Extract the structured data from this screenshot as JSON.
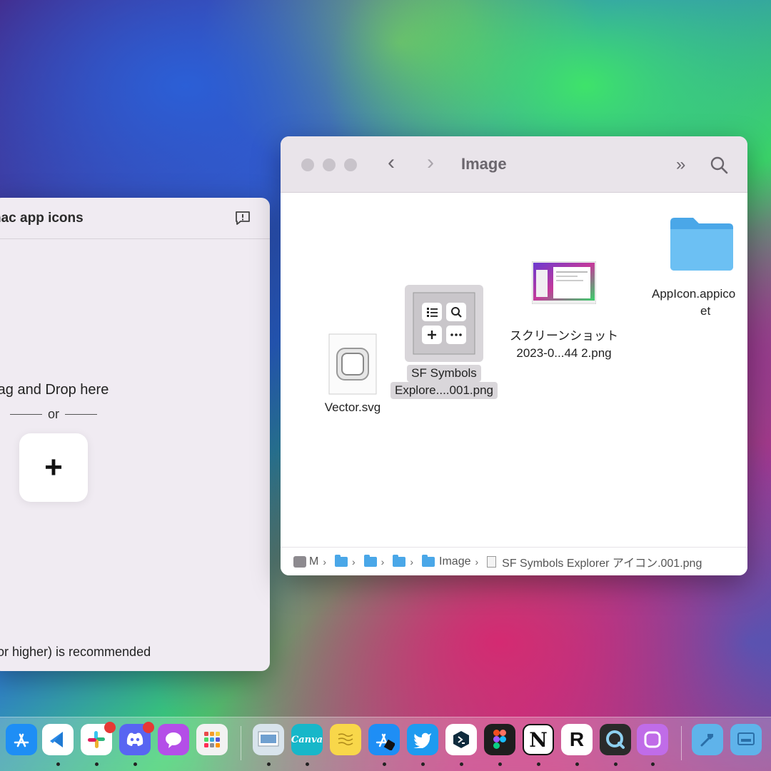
{
  "left_window": {
    "title": "nac app icons",
    "drop_text": "rag and Drop here",
    "or_text": "or",
    "add_label": "+",
    "recommend_text": "(or higher) is recommended"
  },
  "finder": {
    "title": "Image",
    "back": "‹",
    "forward": "›",
    "more": "»",
    "files": [
      {
        "name": "Vector.svg"
      },
      {
        "name_line1": "SF Symbols",
        "name_line2": "Explore....001.png"
      },
      {
        "name_line1": "スクリーンショット",
        "name_line2": "2023-0...44 2.png"
      },
      {
        "name_line1": "AppIcon.appico",
        "name_line2": "et"
      }
    ],
    "path": {
      "drive": "M",
      "folder_last": "Image",
      "file": "SF Symbols Explorer アイコン.001.png"
    }
  },
  "dock": {
    "canva_label": "Canva",
    "notion_label": "N",
    "r_label": "R"
  }
}
